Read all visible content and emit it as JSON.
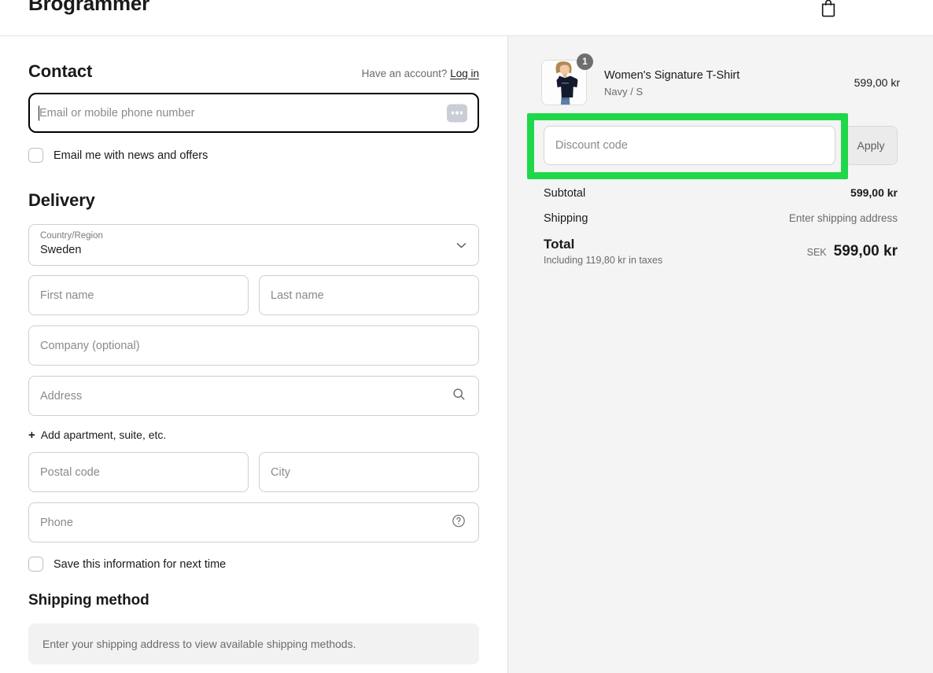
{
  "header": {
    "brand": "Brogrammer",
    "cart_icon": "shopping-bag-icon"
  },
  "contact": {
    "title": "Contact",
    "account_prompt": "Have an account?",
    "login_link": "Log in",
    "email_placeholder": "Email or mobile phone number",
    "autofill_icon": "ellipsis-autofill-icon",
    "newsletter_checkbox_label": "Email me with news and offers",
    "newsletter_checked": false
  },
  "delivery": {
    "title": "Delivery",
    "country_label": "Country/Region",
    "country_value": "Sweden",
    "country_chevron_icon": "chevron-down-icon",
    "first_name_placeholder": "First name",
    "last_name_placeholder": "Last name",
    "company_placeholder": "Company (optional)",
    "address_placeholder": "Address",
    "address_search_icon": "search-icon",
    "add_apartment_label": "Add apartment, suite, etc.",
    "add_apartment_plus": "+",
    "postal_code_placeholder": "Postal code",
    "city_placeholder": "City",
    "phone_placeholder": "Phone",
    "phone_help_icon": "question-circle-icon",
    "save_info_checkbox_label": "Save this information for next time",
    "save_info_checked": false
  },
  "shipping_method": {
    "title": "Shipping method",
    "notice": "Enter your shipping address to view available shipping methods."
  },
  "order_summary": {
    "item": {
      "title": "Women's Signature T-Shirt",
      "variant": "Navy / S",
      "price": "599,00 kr",
      "quantity": "1",
      "image_alt": "navy-tshirt-thumbnail"
    },
    "discount_placeholder": "Discount code",
    "apply_label": "Apply",
    "subtotal_label": "Subtotal",
    "subtotal_value": "599,00 kr",
    "shipping_label": "Shipping",
    "shipping_value": "Enter shipping address",
    "total_label": "Total",
    "total_taxes_note": "Including 119,80 kr in taxes",
    "total_currency": "SEK",
    "total_amount": "599,00 kr"
  },
  "colors": {
    "highlight": "#1fd84a",
    "panel_bg": "#f4f4f4",
    "text": "#1a1a1a",
    "muted": "#6b6b6b"
  }
}
